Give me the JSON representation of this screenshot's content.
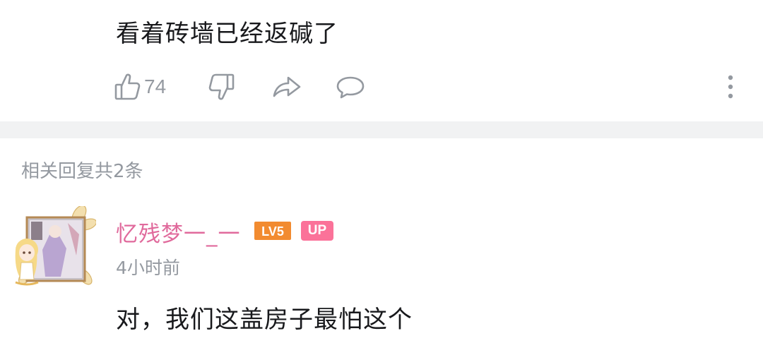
{
  "comment": {
    "text": "看着砖墙已经返碱了",
    "like_count": "74"
  },
  "actions": {
    "like_icon": "thumbs-up-icon",
    "dislike_icon": "thumbs-down-icon",
    "share_icon": "share-icon",
    "reply_icon": "comment-bubble-icon",
    "more_icon": "more-vertical-icon"
  },
  "replies_section": {
    "title": "相关回复共2条"
  },
  "reply": {
    "username": "忆残梦一_一",
    "level": "LV5",
    "badge": "UP",
    "timestamp": "4小时前",
    "text": "对，我们这盖房子最怕这个"
  },
  "colors": {
    "username": "#e06a9c",
    "level_badge": "#f28b30",
    "up_badge": "#fb7299",
    "secondary_text": "#9499a0",
    "primary_text": "#18191c",
    "divider": "#f1f2f3"
  }
}
